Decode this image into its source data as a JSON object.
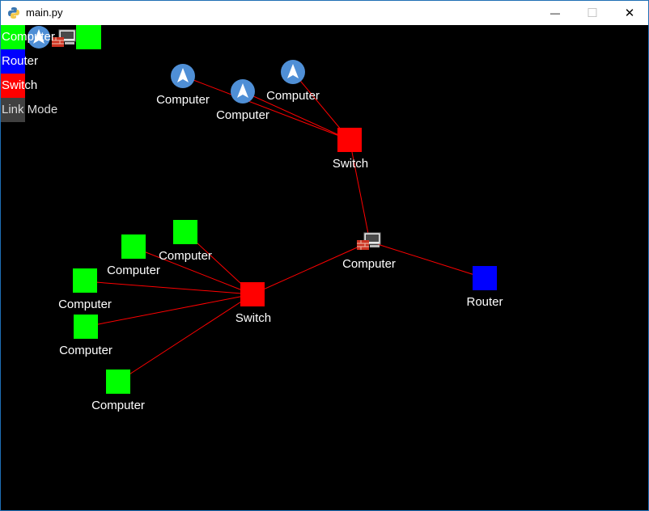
{
  "window": {
    "title": "main.py",
    "minimize_glyph": "—",
    "maximize_glyph": "☐",
    "close_glyph": "✕"
  },
  "palette": {
    "items": [
      {
        "label": "Computer",
        "color": "#00ff00"
      },
      {
        "label": "Router",
        "color": "#0000ff"
      },
      {
        "label": "Switch",
        "color": "#ff0000"
      },
      {
        "label": "Link Mode",
        "color": "#404040"
      }
    ]
  },
  "colors": {
    "canvas_bg": "#000000",
    "computer": "#00ff00",
    "router": "#0000ff",
    "switch": "#ff0000",
    "link": "#ff0000",
    "avatar_circle": "#4f8fd6"
  },
  "nodes": {
    "avatar_computer_1": {
      "label": "Computer",
      "icon": "arrow-avatar-icon"
    },
    "avatar_computer_2": {
      "label": "Computer",
      "icon": "arrow-avatar-icon"
    },
    "avatar_computer_3": {
      "label": "Computer",
      "icon": "arrow-avatar-icon"
    },
    "switch_top": {
      "label": "Switch"
    },
    "firewall_computer": {
      "label": "Computer",
      "icon": "firewall-computer-icon"
    },
    "router": {
      "label": "Router"
    },
    "switch_bottom": {
      "label": "Switch"
    },
    "green_computer_1": {
      "label": "Computer"
    },
    "green_computer_2": {
      "label": "Computer"
    },
    "green_computer_3": {
      "label": "Computer"
    },
    "green_computer_4": {
      "label": "Computer"
    },
    "green_computer_5": {
      "label": "Computer"
    }
  },
  "toolbar_icons": [
    "arrow-avatar-icon",
    "firewall-computer-icon",
    "green-square-icon"
  ]
}
